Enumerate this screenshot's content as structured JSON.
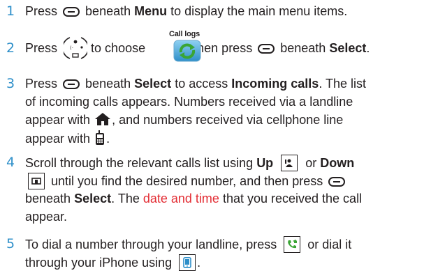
{
  "steps": [
    {
      "number": "1",
      "line1": {
        "t1": "Press",
        "t2": "beneath",
        "t3": "Menu",
        "t4": "to display the main menu items."
      }
    },
    {
      "number": "2",
      "line1": {
        "t1": "Press",
        "t2": "to choose",
        "label": "Call logs",
        "t3": ", then press",
        "t4": "beneath",
        "t5": "Select",
        "t6": "."
      }
    },
    {
      "number": "3",
      "line1": {
        "t1": "Press",
        "t2": "beneath",
        "t3": "Select",
        "t4": "to access",
        "t5": "Incoming calls",
        "t6": ". The list"
      },
      "line2": "of incoming calls appears. Numbers received via a landline",
      "line3": {
        "t1": "appear with",
        "t2": ", and numbers received via cellphone line"
      },
      "line4": {
        "t1": "appear with",
        "t2": "."
      }
    },
    {
      "number": "4",
      "line1": {
        "t1": "Scroll through the relevant calls list using",
        "t2": "Up",
        "t3": "or",
        "t4": "Down"
      },
      "line2": {
        "t1": "until you find the desired number, and then press"
      },
      "line3": {
        "t1": "beneath",
        "t2": "Select",
        "t3": ". The",
        "t4": "date and time",
        "t5": "that you received the call"
      },
      "line4": "appear."
    },
    {
      "number": "5",
      "line1": {
        "t1": "To dial a number through your landline, press",
        "t2": "or dial it"
      },
      "line2": {
        "t1": "through your iPhone using",
        "t2": "."
      }
    }
  ],
  "colors": {
    "step_number": "#2e8fc9",
    "highlight": "#e32d34",
    "icon_green": "#3aa535",
    "icon_blue": "#2e8fc9"
  },
  "icons": [
    "soft-key-icon",
    "nav-pad-icon",
    "call-logs-icon",
    "home-icon",
    "cellphone-icon",
    "up-key-icon",
    "down-key-icon",
    "landline-call-key-icon",
    "iphone-key-icon"
  ]
}
